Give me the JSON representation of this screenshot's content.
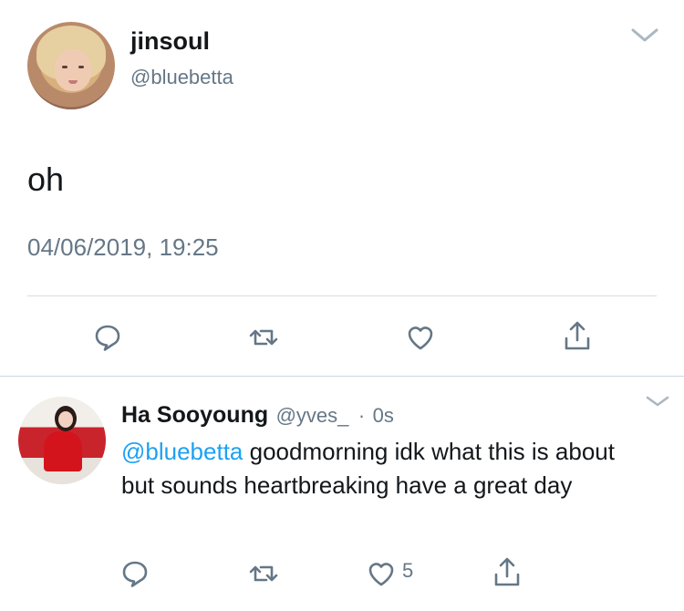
{
  "main_tweet": {
    "display_name": "jinsoul",
    "handle": "@bluebetta",
    "text": "oh",
    "timestamp": "04/06/2019, 19:25"
  },
  "reply": {
    "display_name": "Ha Sooyoung",
    "handle": "@yves_",
    "separator": "·",
    "time": "0s",
    "mention": "@bluebetta",
    "text": " goodmorning idk what this is about but sounds heartbreaking have a great day",
    "like_count": "5"
  },
  "icons": {
    "reply": "reply-icon",
    "retweet": "retweet-icon",
    "like": "heart-icon",
    "share": "share-icon",
    "more": "chevron-down-icon"
  },
  "colors": {
    "text_primary": "#14171a",
    "text_secondary": "#657786",
    "accent": "#1da1f2",
    "divider": "#ccd6dd"
  }
}
